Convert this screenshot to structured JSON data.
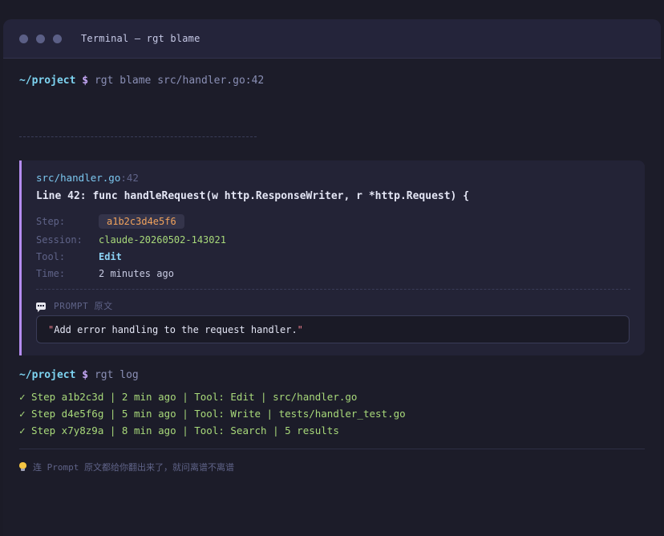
{
  "window": {
    "title": "Terminal — rgt blame"
  },
  "commands": [
    {
      "path": "~/project",
      "dollar": "$",
      "cmd": "rgt blame src/handler.go:42"
    },
    {
      "path": "~/project",
      "dollar": "$",
      "cmd": "rgt log"
    }
  ],
  "blame": {
    "file_name": "src/handler.go",
    "file_line": ":42",
    "code": "Line 42: func handleRequest(w http.ResponseWriter, r *http.Request) {",
    "labels": {
      "step": "Step:",
      "session": "Session:",
      "tool": "Tool:",
      "time": "Time:"
    },
    "step": "a1b2c3d4e5f6",
    "session": "claude-20260502-143021",
    "tool": "Edit",
    "time": "2 minutes ago",
    "prompt_header": "PROMPT 原文",
    "prompt_open_quote": "\"",
    "prompt_text": "Add error handling to the request handler.",
    "prompt_close_quote": "\""
  },
  "log": [
    "✓ Step a1b2c3d | 2 min ago | Tool: Edit | src/handler.go",
    "✓ Step d4e5f6g | 5 min ago | Tool: Write | tests/handler_test.go",
    "✓ Step x7y8z9a | 8 min ago | Tool: Search | 5 results"
  ],
  "tip": "连 Prompt 原文都给你翻出来了，就问离谱不离谱",
  "icons": {
    "window_controls": [
      "window-dot-icon",
      "window-dot-icon",
      "window-dot-icon"
    ],
    "prompt": "chat-bubble-icon",
    "tip": "lightbulb-icon"
  },
  "colors": {
    "background": "#1b1b27",
    "titlebar": "#24243a",
    "accent": "#b58cf0",
    "path": "#7dd3f0",
    "success": "#a8d97a",
    "hash": "#f0a25c"
  }
}
